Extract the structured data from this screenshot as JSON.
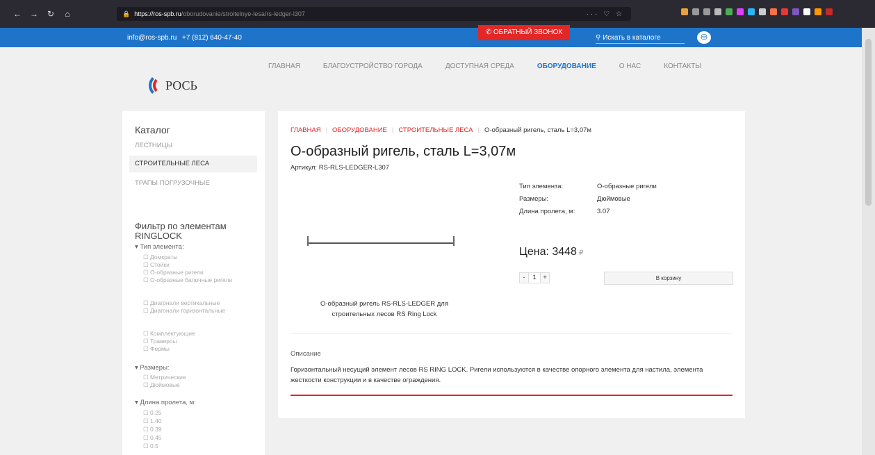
{
  "browser": {
    "url_host": "https://ros-spb.ru",
    "url_path": "/oborudovanie/stroitelnye-lesa/rs-ledger-l307",
    "nav_icons": [
      "back-icon",
      "forward-icon",
      "reload-icon",
      "home-icon"
    ]
  },
  "topbar": {
    "email": "info@ros-spb.ru",
    "phone": "+7 (812) 640-47-40",
    "callback": "ОБРАТНЫЙ ЗВОНОК",
    "search": "Искать в каталоге"
  },
  "logo": "РОСЬ",
  "menu": [
    "ГЛАВНАЯ",
    "БЛАГОУСТРОЙСТВО ГОРОДА",
    "ДОСТУПНАЯ СРЕДА",
    "ОБОРУДОВАНИЕ",
    "О НАС",
    "КОНТАКТЫ"
  ],
  "sidebar": {
    "title": "Каталог",
    "categories": [
      "ЛЕСТНИЦЫ",
      "СТРОИТЕЛЬНЫЕ ЛЕСА",
      "ТРАПЫ ПОГРУЗОЧНЫЕ"
    ],
    "filter_title": "Фильтр по элементам RINGLOCK",
    "groups": [
      {
        "label": "Тип элемента:",
        "options": [
          "Домкраты",
          "Стойки",
          "О-образные ригели",
          "О-образные балочные ригели",
          "Диагонали вертикальные",
          "Диагонали горизонтальные",
          "Комплектующие",
          "Траверсы",
          "Фермы"
        ]
      },
      {
        "label": "Размеры:",
        "options": [
          "Метрические",
          "Дюймовые"
        ]
      },
      {
        "label": "Длина пролета, м:",
        "options": [
          "0.25",
          "1.40",
          "0.39",
          "0.45",
          "0.5"
        ]
      }
    ]
  },
  "product": {
    "breadcrumbs": [
      "ГЛАВНАЯ",
      "ОБОРУДОВАНИЕ",
      "СТРОИТЕЛЬНЫЕ ЛЕСА",
      "О-образный ригель, сталь L=3,07м"
    ],
    "title": "О-образный ригель, сталь L=3,07м",
    "sku": "Артикул: RS-RLS-LEDGER-L307",
    "attributes": [
      {
        "key": "Тип элемента:",
        "value": "О-образные ригели"
      },
      {
        "key": "Размеры:",
        "value": "Дюймовые"
      },
      {
        "key": "Длина пролета, м:",
        "value": "3.07"
      }
    ],
    "caption": "О-образный ригель RS-RLS-LEDGER для строительных лесов RS Ring Lock",
    "price": "Цена: 3448",
    "currency_icon": "ruble-icon",
    "qty_minus": "-",
    "qty": "1",
    "qty_plus": "+",
    "buy": "В корзину",
    "desc_label": "Описание",
    "desc": "Горизонтальный несущий элемент лесов RS RING LOCK. Ригели используются в качестве опорного элемента для настила, элемента жесткости конструкции и в качестве ограждения."
  },
  "colors": {
    "brand": "#1e74c8",
    "accent": "#e32626"
  }
}
